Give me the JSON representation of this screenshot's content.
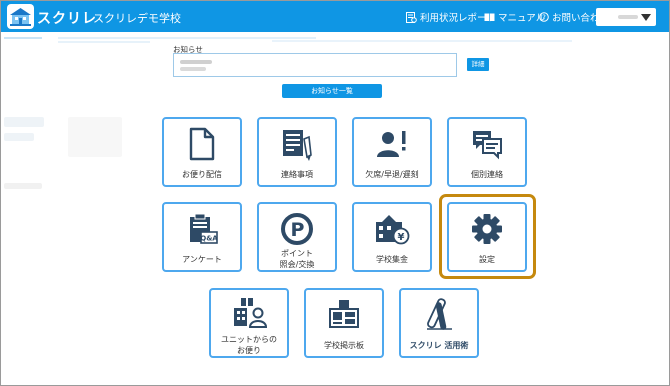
{
  "header": {
    "brand": "スクリレ",
    "school": "スクリレデモ学校",
    "nav": {
      "usage_report": "利用状況レポート",
      "manual": "マニュアル",
      "contact": "お問い合わせ"
    }
  },
  "notice": {
    "label": "お知らせ",
    "detail_button": "詳細",
    "list_button": "お知らせ一覧"
  },
  "tiles": [
    {
      "line1": "お便り配信",
      "line2": ""
    },
    {
      "line1": "連絡事項",
      "line2": ""
    },
    {
      "line1": "欠席/早退/遅刻",
      "line2": ""
    },
    {
      "line1": "個別連絡",
      "line2": ""
    },
    {
      "line1": "アンケート",
      "line2": ""
    },
    {
      "line1": "ポイント",
      "line2": "照会/交換"
    },
    {
      "line1": "学校集金",
      "line2": ""
    },
    {
      "line1": "設定",
      "line2": ""
    },
    {
      "line1": "ユニットからの",
      "line2": "お便り"
    },
    {
      "line1": "学校掲示板",
      "line2": ""
    },
    {
      "line1": "スクリレ 活用術",
      "line2": ""
    }
  ],
  "icon_text": {
    "qa": "Q&A",
    "p": "P",
    "yen": "¥"
  },
  "colors": {
    "header_blue": "#0f96e4",
    "tile_border": "#4ea8ee",
    "icon_dark": "#2e4a66",
    "highlight": "#c5890e"
  }
}
